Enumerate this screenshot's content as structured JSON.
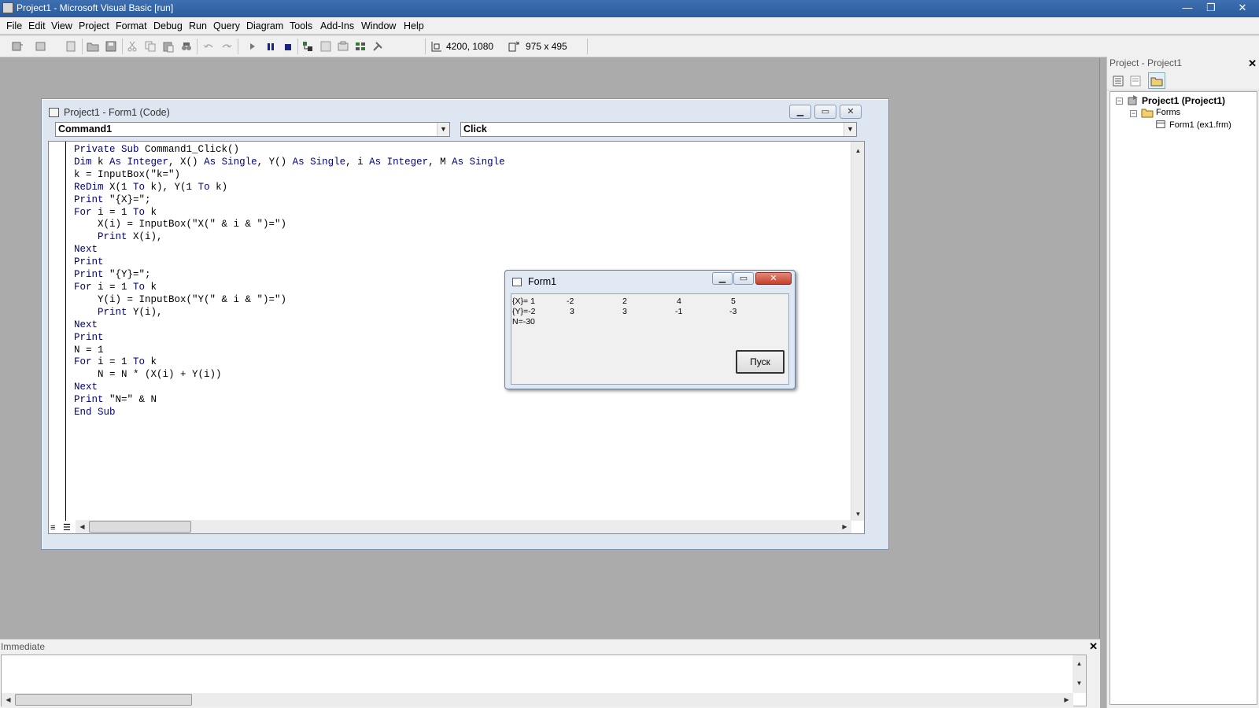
{
  "window": {
    "title": "Project1 - Microsoft Visual Basic [run]",
    "minimize": "—",
    "restore": "❐",
    "close": "✕"
  },
  "menu": [
    "File",
    "Edit",
    "View",
    "Project",
    "Format",
    "Debug",
    "Run",
    "Query",
    "Diagram",
    "Tools",
    "Add-Ins",
    "Window",
    "Help"
  ],
  "toolbar": {
    "position": "4200, 1080",
    "size": "975 x 495"
  },
  "code_window": {
    "title": "Project1 - Form1 (Code)",
    "object_combo": "Command1",
    "procedure_combo": "Click",
    "lines": [
      [
        {
          "k": "Private Sub"
        },
        {
          "t": " Command1_Click()"
        }
      ],
      [
        {
          "k": "Dim"
        },
        {
          "t": " k "
        },
        {
          "k": "As Integer"
        },
        {
          "t": ", X() "
        },
        {
          "k": "As Single"
        },
        {
          "t": ", Y() "
        },
        {
          "k": "As Single"
        },
        {
          "t": ", i "
        },
        {
          "k": "As Integer"
        },
        {
          "t": ", M "
        },
        {
          "k": "As Single"
        }
      ],
      [
        {
          "t": "k = InputBox(\"k=\")"
        }
      ],
      [
        {
          "k": "ReDim"
        },
        {
          "t": " X(1 "
        },
        {
          "k": "To"
        },
        {
          "t": " k), Y(1 "
        },
        {
          "k": "To"
        },
        {
          "t": " k)"
        }
      ],
      [
        {
          "k": "Print"
        },
        {
          "t": " \"{X}=\";"
        }
      ],
      [
        {
          "k": "For"
        },
        {
          "t": " i = 1 "
        },
        {
          "k": "To"
        },
        {
          "t": " k"
        }
      ],
      [
        {
          "t": "    X(i) = InputBox(\"X(\" & i & \")=\")"
        }
      ],
      [
        {
          "t": "    "
        },
        {
          "k": "Print"
        },
        {
          "t": " X(i),"
        }
      ],
      [
        {
          "k": "Next"
        }
      ],
      [
        {
          "k": "Print"
        }
      ],
      [
        {
          "k": "Print"
        },
        {
          "t": " \"{Y}=\";"
        }
      ],
      [
        {
          "k": "For"
        },
        {
          "t": " i = 1 "
        },
        {
          "k": "To"
        },
        {
          "t": " k"
        }
      ],
      [
        {
          "t": "    Y(i) = InputBox(\"Y(\" & i & \")=\")"
        }
      ],
      [
        {
          "t": "    "
        },
        {
          "k": "Print"
        },
        {
          "t": " Y(i),"
        }
      ],
      [
        {
          "k": "Next"
        }
      ],
      [
        {
          "k": "Print"
        }
      ],
      [
        {
          "t": "N = 1"
        }
      ],
      [
        {
          "k": "For"
        },
        {
          "t": " i = 1 "
        },
        {
          "k": "To"
        },
        {
          "t": " k"
        }
      ],
      [
        {
          "t": "    N = N * (X(i) + Y(i))"
        }
      ],
      [
        {
          "k": "Next"
        }
      ],
      [
        {
          "k": "Print"
        },
        {
          "t": " \"N=\" & N"
        }
      ],
      [
        {
          "k": "End Sub"
        }
      ]
    ]
  },
  "form1": {
    "title": "Form1",
    "output": {
      "row1": [
        "{X}= 1",
        "-2",
        "2",
        "4",
        "5"
      ],
      "row2": [
        "{Y}=-2",
        "3",
        "3",
        "-1",
        "-3"
      ],
      "row3": "N=-30"
    },
    "button": "Пуск"
  },
  "project_pane": {
    "title": "Project - Project1",
    "tree": {
      "project": "Project1 (Project1)",
      "forms": "Forms",
      "form": "Form1 (ex1.frm)"
    }
  },
  "immediate": {
    "title": "Immediate"
  },
  "colors": {
    "keyword": "#00007f",
    "titlebar": "#2b5c9e"
  }
}
